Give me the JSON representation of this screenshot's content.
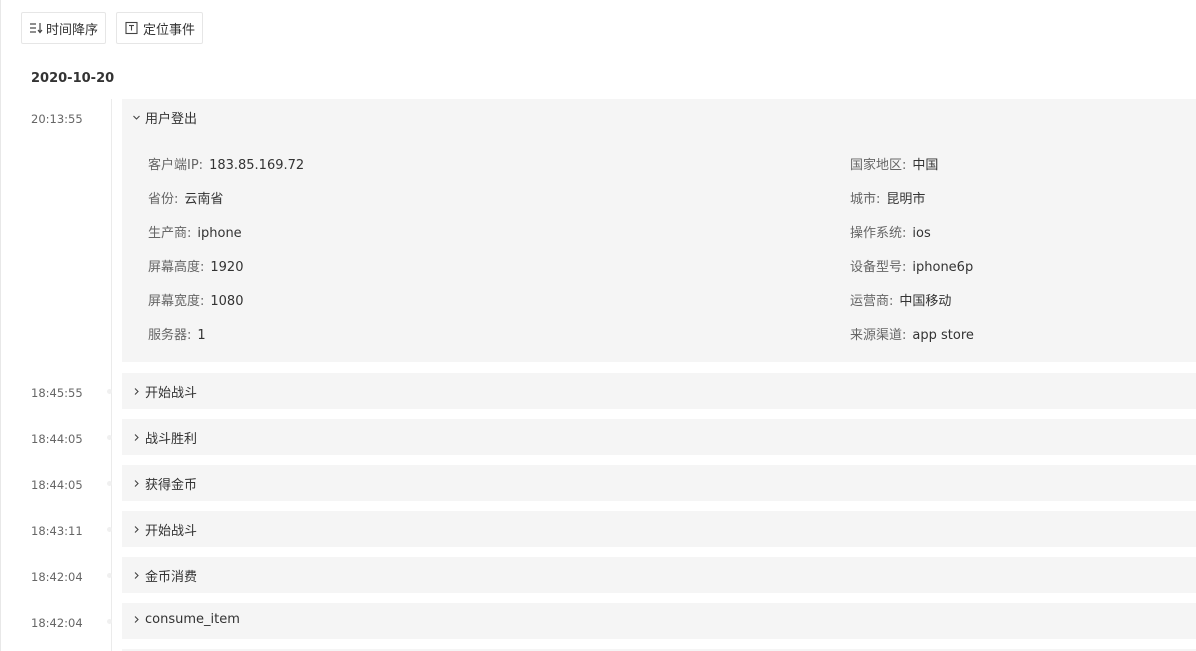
{
  "toolbar": {
    "sort_label": "时间降序",
    "locate_label": "定位事件"
  },
  "date": "2020-10-20",
  "events": [
    {
      "time": "20:13:55",
      "name": "用户登出",
      "expanded": true,
      "props": [
        {
          "key": "客户端IP:",
          "value": "183.85.169.72"
        },
        {
          "key": "国家地区:",
          "value": "中国"
        },
        {
          "key": "省份:",
          "value": "云南省"
        },
        {
          "key": "城市:",
          "value": "昆明市"
        },
        {
          "key": "生产商:",
          "value": "iphone"
        },
        {
          "key": "操作系统:",
          "value": "ios"
        },
        {
          "key": "屏幕高度:",
          "value": "1920"
        },
        {
          "key": "设备型号:",
          "value": "iphone6p"
        },
        {
          "key": "屏幕宽度:",
          "value": "1080"
        },
        {
          "key": "运营商:",
          "value": "中国移动"
        },
        {
          "key": "服务器:",
          "value": "1"
        },
        {
          "key": "来源渠道:",
          "value": "app store"
        }
      ]
    },
    {
      "time": "18:45:55",
      "name": "开始战斗",
      "expanded": false
    },
    {
      "time": "18:44:05",
      "name": "战斗胜利",
      "expanded": false
    },
    {
      "time": "18:44:05",
      "name": "获得金币",
      "expanded": false
    },
    {
      "time": "18:43:11",
      "name": "开始战斗",
      "expanded": false
    },
    {
      "time": "18:42:04",
      "name": "金币消费",
      "expanded": false
    },
    {
      "time": "18:42:04",
      "name": "consume_item",
      "expanded": false
    }
  ],
  "colors": {
    "card_bg": "#f5f5f5",
    "text": "#333333",
    "muted": "#666666"
  }
}
